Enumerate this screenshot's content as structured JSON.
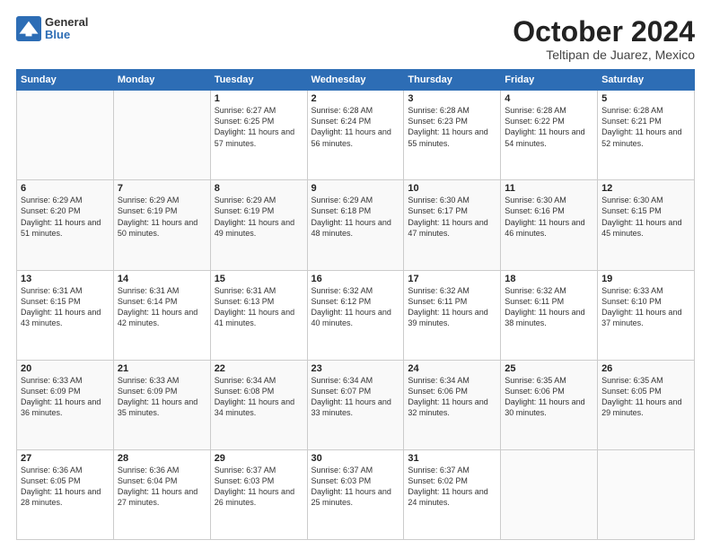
{
  "logo": {
    "general": "General",
    "blue": "Blue"
  },
  "title": "October 2024",
  "subtitle": "Teltipan de Juarez, Mexico",
  "header_days": [
    "Sunday",
    "Monday",
    "Tuesday",
    "Wednesday",
    "Thursday",
    "Friday",
    "Saturday"
  ],
  "weeks": [
    [
      {
        "day": "",
        "sunrise": "",
        "sunset": "",
        "daylight": ""
      },
      {
        "day": "",
        "sunrise": "",
        "sunset": "",
        "daylight": ""
      },
      {
        "day": "1",
        "sunrise": "Sunrise: 6:27 AM",
        "sunset": "Sunset: 6:25 PM",
        "daylight": "Daylight: 11 hours and 57 minutes."
      },
      {
        "day": "2",
        "sunrise": "Sunrise: 6:28 AM",
        "sunset": "Sunset: 6:24 PM",
        "daylight": "Daylight: 11 hours and 56 minutes."
      },
      {
        "day": "3",
        "sunrise": "Sunrise: 6:28 AM",
        "sunset": "Sunset: 6:23 PM",
        "daylight": "Daylight: 11 hours and 55 minutes."
      },
      {
        "day": "4",
        "sunrise": "Sunrise: 6:28 AM",
        "sunset": "Sunset: 6:22 PM",
        "daylight": "Daylight: 11 hours and 54 minutes."
      },
      {
        "day": "5",
        "sunrise": "Sunrise: 6:28 AM",
        "sunset": "Sunset: 6:21 PM",
        "daylight": "Daylight: 11 hours and 52 minutes."
      }
    ],
    [
      {
        "day": "6",
        "sunrise": "Sunrise: 6:29 AM",
        "sunset": "Sunset: 6:20 PM",
        "daylight": "Daylight: 11 hours and 51 minutes."
      },
      {
        "day": "7",
        "sunrise": "Sunrise: 6:29 AM",
        "sunset": "Sunset: 6:19 PM",
        "daylight": "Daylight: 11 hours and 50 minutes."
      },
      {
        "day": "8",
        "sunrise": "Sunrise: 6:29 AM",
        "sunset": "Sunset: 6:19 PM",
        "daylight": "Daylight: 11 hours and 49 minutes."
      },
      {
        "day": "9",
        "sunrise": "Sunrise: 6:29 AM",
        "sunset": "Sunset: 6:18 PM",
        "daylight": "Daylight: 11 hours and 48 minutes."
      },
      {
        "day": "10",
        "sunrise": "Sunrise: 6:30 AM",
        "sunset": "Sunset: 6:17 PM",
        "daylight": "Daylight: 11 hours and 47 minutes."
      },
      {
        "day": "11",
        "sunrise": "Sunrise: 6:30 AM",
        "sunset": "Sunset: 6:16 PM",
        "daylight": "Daylight: 11 hours and 46 minutes."
      },
      {
        "day": "12",
        "sunrise": "Sunrise: 6:30 AM",
        "sunset": "Sunset: 6:15 PM",
        "daylight": "Daylight: 11 hours and 45 minutes."
      }
    ],
    [
      {
        "day": "13",
        "sunrise": "Sunrise: 6:31 AM",
        "sunset": "Sunset: 6:15 PM",
        "daylight": "Daylight: 11 hours and 43 minutes."
      },
      {
        "day": "14",
        "sunrise": "Sunrise: 6:31 AM",
        "sunset": "Sunset: 6:14 PM",
        "daylight": "Daylight: 11 hours and 42 minutes."
      },
      {
        "day": "15",
        "sunrise": "Sunrise: 6:31 AM",
        "sunset": "Sunset: 6:13 PM",
        "daylight": "Daylight: 11 hours and 41 minutes."
      },
      {
        "day": "16",
        "sunrise": "Sunrise: 6:32 AM",
        "sunset": "Sunset: 6:12 PM",
        "daylight": "Daylight: 11 hours and 40 minutes."
      },
      {
        "day": "17",
        "sunrise": "Sunrise: 6:32 AM",
        "sunset": "Sunset: 6:11 PM",
        "daylight": "Daylight: 11 hours and 39 minutes."
      },
      {
        "day": "18",
        "sunrise": "Sunrise: 6:32 AM",
        "sunset": "Sunset: 6:11 PM",
        "daylight": "Daylight: 11 hours and 38 minutes."
      },
      {
        "day": "19",
        "sunrise": "Sunrise: 6:33 AM",
        "sunset": "Sunset: 6:10 PM",
        "daylight": "Daylight: 11 hours and 37 minutes."
      }
    ],
    [
      {
        "day": "20",
        "sunrise": "Sunrise: 6:33 AM",
        "sunset": "Sunset: 6:09 PM",
        "daylight": "Daylight: 11 hours and 36 minutes."
      },
      {
        "day": "21",
        "sunrise": "Sunrise: 6:33 AM",
        "sunset": "Sunset: 6:09 PM",
        "daylight": "Daylight: 11 hours and 35 minutes."
      },
      {
        "day": "22",
        "sunrise": "Sunrise: 6:34 AM",
        "sunset": "Sunset: 6:08 PM",
        "daylight": "Daylight: 11 hours and 34 minutes."
      },
      {
        "day": "23",
        "sunrise": "Sunrise: 6:34 AM",
        "sunset": "Sunset: 6:07 PM",
        "daylight": "Daylight: 11 hours and 33 minutes."
      },
      {
        "day": "24",
        "sunrise": "Sunrise: 6:34 AM",
        "sunset": "Sunset: 6:06 PM",
        "daylight": "Daylight: 11 hours and 32 minutes."
      },
      {
        "day": "25",
        "sunrise": "Sunrise: 6:35 AM",
        "sunset": "Sunset: 6:06 PM",
        "daylight": "Daylight: 11 hours and 30 minutes."
      },
      {
        "day": "26",
        "sunrise": "Sunrise: 6:35 AM",
        "sunset": "Sunset: 6:05 PM",
        "daylight": "Daylight: 11 hours and 29 minutes."
      }
    ],
    [
      {
        "day": "27",
        "sunrise": "Sunrise: 6:36 AM",
        "sunset": "Sunset: 6:05 PM",
        "daylight": "Daylight: 11 hours and 28 minutes."
      },
      {
        "day": "28",
        "sunrise": "Sunrise: 6:36 AM",
        "sunset": "Sunset: 6:04 PM",
        "daylight": "Daylight: 11 hours and 27 minutes."
      },
      {
        "day": "29",
        "sunrise": "Sunrise: 6:37 AM",
        "sunset": "Sunset: 6:03 PM",
        "daylight": "Daylight: 11 hours and 26 minutes."
      },
      {
        "day": "30",
        "sunrise": "Sunrise: 6:37 AM",
        "sunset": "Sunset: 6:03 PM",
        "daylight": "Daylight: 11 hours and 25 minutes."
      },
      {
        "day": "31",
        "sunrise": "Sunrise: 6:37 AM",
        "sunset": "Sunset: 6:02 PM",
        "daylight": "Daylight: 11 hours and 24 minutes."
      },
      {
        "day": "",
        "sunrise": "",
        "sunset": "",
        "daylight": ""
      },
      {
        "day": "",
        "sunrise": "",
        "sunset": "",
        "daylight": ""
      }
    ]
  ]
}
